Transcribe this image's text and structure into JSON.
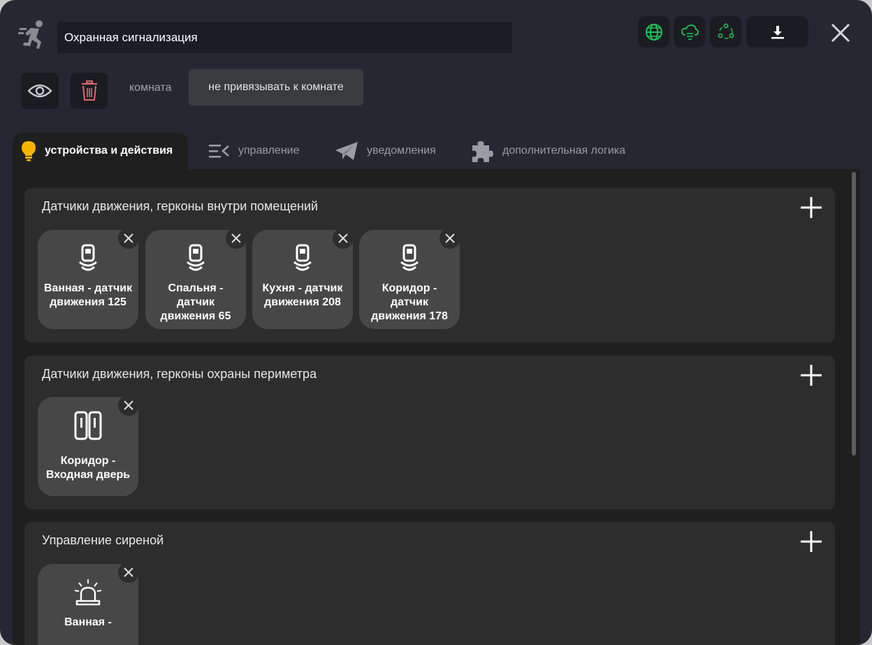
{
  "header": {
    "title_value": "Охранная сигнализация",
    "icons": [
      "running-person-icon",
      "globe-icon",
      "cloud-sync-icon",
      "share-network-icon",
      "download-icon",
      "close-icon"
    ],
    "accent_green": "#1ec25a"
  },
  "toolbar": {
    "room_label": "комната",
    "room_value": "не привязывать к комнате",
    "icons": [
      "eye-icon",
      "trash-icon"
    ],
    "trash_color": "#e06b6b"
  },
  "tabs": [
    {
      "label": "устройства и действия",
      "icon": "lightbulb-icon",
      "active": true
    },
    {
      "label": "управление",
      "icon": "list-collapse-icon",
      "active": false
    },
    {
      "label": "уведомления",
      "icon": "telegram-icon",
      "active": false
    },
    {
      "label": "дополнительная логика",
      "icon": "puzzle-icon",
      "active": false
    }
  ],
  "groups": [
    {
      "title": "Датчики движения, герконы внутри помещений",
      "devices": [
        {
          "label": "Ванная - датчик движения 125",
          "icon": "motion-sensor-icon"
        },
        {
          "label": "Спальня - датчик движения 65",
          "icon": "motion-sensor-icon"
        },
        {
          "label": "Кухня - датчик движения 208",
          "icon": "motion-sensor-icon"
        },
        {
          "label": "Коридор - датчик движения 178",
          "icon": "motion-sensor-icon"
        }
      ]
    },
    {
      "title": "Датчики движения, герконы охраны периметра",
      "devices": [
        {
          "label": "Коридор - Входная дверь",
          "icon": "door-contact-icon"
        }
      ]
    },
    {
      "title": "Управление сиреной",
      "devices": [
        {
          "label": "Ванная -",
          "icon": "siren-icon"
        }
      ]
    }
  ]
}
